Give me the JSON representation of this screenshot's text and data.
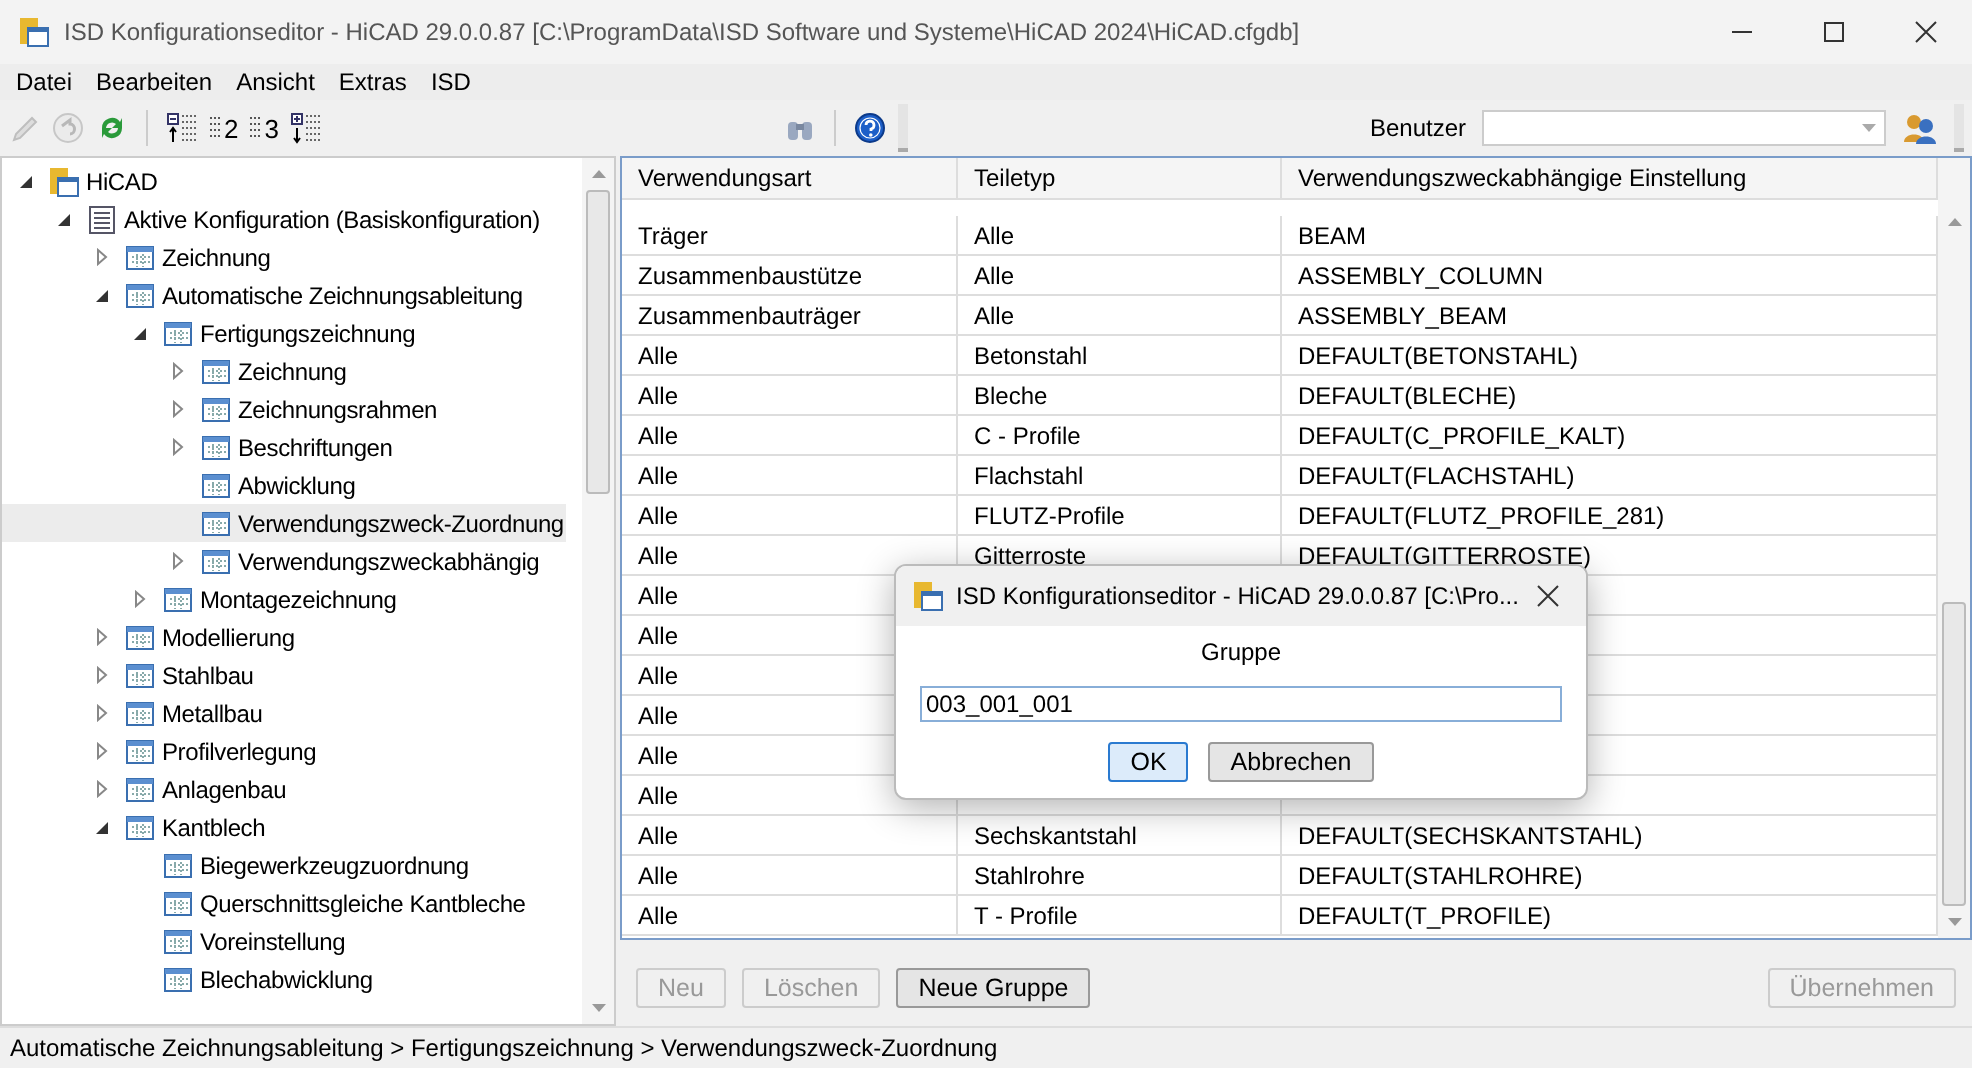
{
  "window": {
    "title": "ISD Konfigurationseditor  - HiCAD 29.0.0.87 [C:\\ProgramData\\ISD Software und Systeme\\HiCAD 2024\\HiCAD.cfgdb]"
  },
  "menu": [
    "Datei",
    "Bearbeiten",
    "Ansicht",
    "Extras",
    "ISD"
  ],
  "toolbar": [
    {
      "kind": "pencil",
      "disabled": true
    },
    {
      "kind": "undo",
      "disabled": true
    },
    {
      "kind": "refresh",
      "disabled": false
    },
    {
      "kind": "sep"
    },
    {
      "kind": "collapse"
    },
    {
      "kind": "level",
      "label": "2"
    },
    {
      "kind": "level",
      "label": "3"
    },
    {
      "kind": "expand"
    }
  ],
  "toolbar_right": [
    {
      "kind": "binoculars"
    },
    {
      "kind": "sep"
    },
    {
      "kind": "help"
    }
  ],
  "user": {
    "label": "Benutzer"
  },
  "tree": [
    {
      "label": "HiCAD",
      "kind": "root",
      "expanded": true,
      "selected": false,
      "children": [
        {
          "label": "Aktive Konfiguration (Basiskonfiguration)",
          "kind": "config",
          "expanded": true,
          "selected": false,
          "children": [
            {
              "label": "Zeichnung",
              "kind": "table",
              "expanded": false,
              "selected": false
            },
            {
              "label": "Automatische Zeichnungsableitung",
              "kind": "table",
              "expanded": true,
              "selected": false,
              "children": [
                {
                  "label": "Fertigungszeichnung",
                  "kind": "table",
                  "expanded": true,
                  "selected": false,
                  "children": [
                    {
                      "label": "Zeichnung",
                      "kind": "table",
                      "expanded": false,
                      "selected": false
                    },
                    {
                      "label": "Zeichnungsrahmen",
                      "kind": "table",
                      "expanded": false,
                      "selected": false
                    },
                    {
                      "label": "Beschriftungen",
                      "kind": "table",
                      "expanded": false,
                      "selected": false
                    },
                    {
                      "label": "Abwicklung",
                      "kind": "table",
                      "selected": false
                    },
                    {
                      "label": "Verwendungszweck-Zuordnung",
                      "kind": "table",
                      "selected": true
                    },
                    {
                      "label": "Verwendungszweckabhängig",
                      "kind": "table",
                      "expanded": false,
                      "selected": false
                    }
                  ]
                },
                {
                  "label": "Montagezeichnung",
                  "kind": "table",
                  "expanded": false,
                  "selected": false
                }
              ]
            },
            {
              "label": "Modellierung",
              "kind": "table",
              "expanded": false,
              "selected": false
            },
            {
              "label": "Stahlbau",
              "kind": "table",
              "expanded": false,
              "selected": false
            },
            {
              "label": "Metallbau",
              "kind": "table",
              "expanded": false,
              "selected": false
            },
            {
              "label": "Profilverlegung",
              "kind": "table",
              "expanded": false,
              "selected": false
            },
            {
              "label": "Anlagenbau",
              "kind": "table",
              "expanded": false,
              "selected": false
            },
            {
              "label": "Kantblech",
              "kind": "table",
              "expanded": true,
              "selected": false,
              "children": [
                {
                  "label": "Biegewerkzeugzuordnung",
                  "kind": "table",
                  "selected": false
                },
                {
                  "label": "Querschnittsgleiche Kantbleche",
                  "kind": "table",
                  "selected": false
                },
                {
                  "label": "Voreinstellung",
                  "kind": "table",
                  "selected": false
                },
                {
                  "label": "Blechabwicklung",
                  "kind": "table",
                  "selected": false
                }
              ]
            }
          ]
        }
      ]
    }
  ],
  "table": {
    "columns": [
      "Verwendungsart",
      "Teiletyp",
      "Verwendungszweckabhängige Einstellung"
    ],
    "rows": [
      [
        "Träger",
        "Alle",
        "BEAM"
      ],
      [
        "Zusammenbaustütze",
        "Alle",
        "ASSEMBLY_COLUMN"
      ],
      [
        "Zusammenbauträger",
        "Alle",
        "ASSEMBLY_BEAM"
      ],
      [
        "Alle",
        "Betonstahl",
        "DEFAULT(BETONSTAHL)"
      ],
      [
        "Alle",
        "Bleche",
        "DEFAULT(BLECHE)"
      ],
      [
        "Alle",
        "C - Profile",
        "DEFAULT(C_PROFILE_KALT)"
      ],
      [
        "Alle",
        "Flachstahl",
        "DEFAULT(FLACHSTAHL)"
      ],
      [
        "Alle",
        "FLUTZ-Profile",
        "DEFAULT(FLUTZ_PROFILE_281)"
      ],
      [
        "Alle",
        "Gitterroste",
        "DEFAULT(GITTERROSTE)"
      ],
      [
        "Alle"
      ],
      [
        "Alle"
      ],
      [
        "Alle"
      ],
      [
        "Alle"
      ],
      [
        "Alle"
      ],
      [
        "Alle"
      ],
      [
        "Alle",
        "Sechskantstahl",
        "DEFAULT(SECHSKANTSTAHL)"
      ],
      [
        "Alle",
        "Stahlrohre",
        "DEFAULT(STAHLROHRE)"
      ],
      [
        "Alle",
        "T - Profile",
        "DEFAULT(T_PROFILE)"
      ]
    ]
  },
  "buttons": [
    {
      "label": "Neu",
      "disabled": true
    },
    {
      "label": "Löschen",
      "disabled": true
    },
    {
      "label": "Neue Gruppe",
      "disabled": false
    }
  ],
  "apply_button": {
    "label": "Übernehmen",
    "disabled": true
  },
  "status_bar": "Automatische Zeichnungsableitung > Fertigungszeichnung > Verwendungszweck-Zuordnung",
  "dialog": {
    "title": "ISD Konfigurationseditor  - HiCAD 29.0.0.87 [C:\\Pro...",
    "label": "Gruppe",
    "value": "003_001_001",
    "buttons": [
      {
        "label": "OK",
        "default": true
      },
      {
        "label": "Abbrechen",
        "default": false
      }
    ]
  }
}
